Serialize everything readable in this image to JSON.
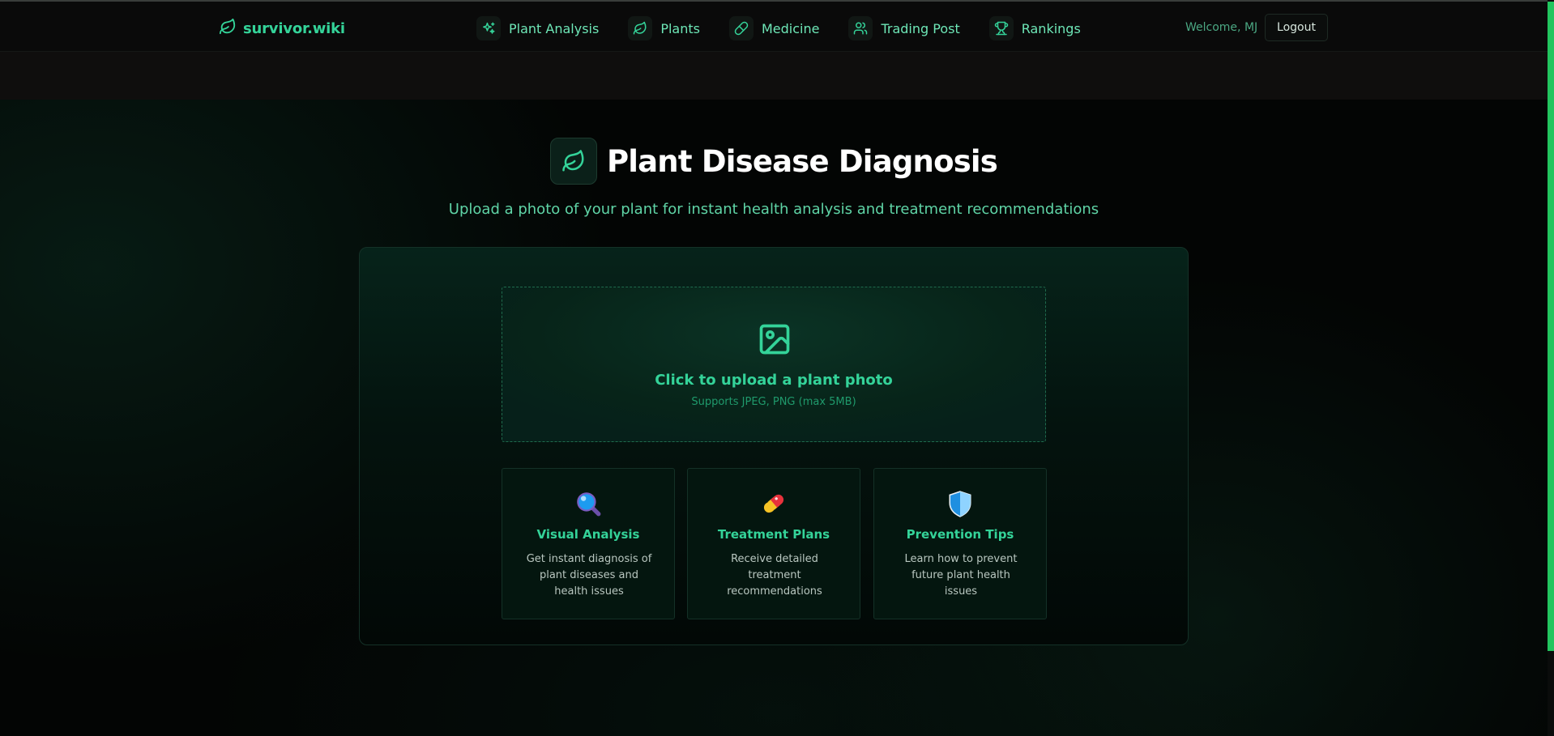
{
  "brand": {
    "name": "survivor.wiki",
    "icon": "leaf-icon"
  },
  "nav": {
    "items": [
      {
        "label": "Plant Analysis",
        "icon": "sparkles-icon"
      },
      {
        "label": "Plants",
        "icon": "leaf-icon"
      },
      {
        "label": "Medicine",
        "icon": "pill-icon"
      },
      {
        "label": "Trading Post",
        "icon": "users-icon"
      },
      {
        "label": "Rankings",
        "icon": "trophy-icon"
      }
    ],
    "welcome": "Welcome, MJ",
    "logout_label": "Logout"
  },
  "hero": {
    "title": "Plant Disease Diagnosis",
    "subtitle": "Upload a photo of your plant for instant health analysis and treatment recommendations",
    "icon": "leaf-icon"
  },
  "upload": {
    "title": "Click to upload a plant photo",
    "hint": "Supports JPEG, PNG (max 5MB)",
    "icon": "image-icon"
  },
  "features": [
    {
      "title": "Visual Analysis",
      "description": "Get instant diagnosis of plant diseases and health issues",
      "icon": "magnifier-icon"
    },
    {
      "title": "Treatment Plans",
      "description": "Receive detailed treatment recommendations",
      "icon": "pill-icon"
    },
    {
      "title": "Prevention Tips",
      "description": "Learn how to prevent future plant health issues",
      "icon": "shield-icon"
    }
  ],
  "colors": {
    "accent": "#34d399",
    "accent_light": "#6ee7b7",
    "background": "#040605",
    "scrollbar": "#22c55e"
  }
}
